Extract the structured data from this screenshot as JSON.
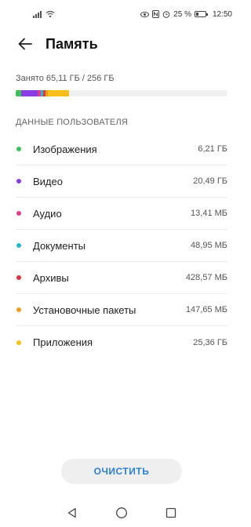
{
  "status_bar": {
    "battery": "25 %",
    "time": "12:50"
  },
  "header": {
    "title": "Память",
    "back_icon": "arrow-left-icon"
  },
  "storage": {
    "used_text": "Занято 65,11 ГБ / 256 ГБ",
    "used_fraction": 0.254,
    "segments": [
      {
        "color": "#3cc15a",
        "fraction": 0.025
      },
      {
        "color": "#8a3be3",
        "fraction": 0.08
      },
      {
        "color": "#e23b8a",
        "fraction": 0.012
      },
      {
        "color": "#25b8d4",
        "fraction": 0.012
      },
      {
        "color": "#e0363b",
        "fraction": 0.012
      },
      {
        "color": "#f39a1d",
        "fraction": 0.012
      },
      {
        "color": "#f8bf1a",
        "fraction": 0.1
      }
    ]
  },
  "section_title": "ДАННЫЕ ПОЛЬЗОВАТЕЛЯ",
  "items": [
    {
      "label": "Изображения",
      "size": "6,21 ГБ",
      "color": "#3cc15a"
    },
    {
      "label": "Видео",
      "size": "20,49 ГБ",
      "color": "#8a3be3"
    },
    {
      "label": "Аудио",
      "size": "13,41 МБ",
      "color": "#e23b8a"
    },
    {
      "label": "Документы",
      "size": "48,95 МБ",
      "color": "#25b8d4"
    },
    {
      "label": "Архивы",
      "size": "428,57 МБ",
      "color": "#e0363b"
    },
    {
      "label": "Установочные пакеты",
      "size": "147,65 МБ",
      "color": "#f39a1d"
    },
    {
      "label": "Приложения",
      "size": "25,36 ГБ",
      "color": "#f8bf1a"
    }
  ],
  "clear_button": "ОЧИСТИТЬ",
  "accent_color": "#2a7fd4"
}
